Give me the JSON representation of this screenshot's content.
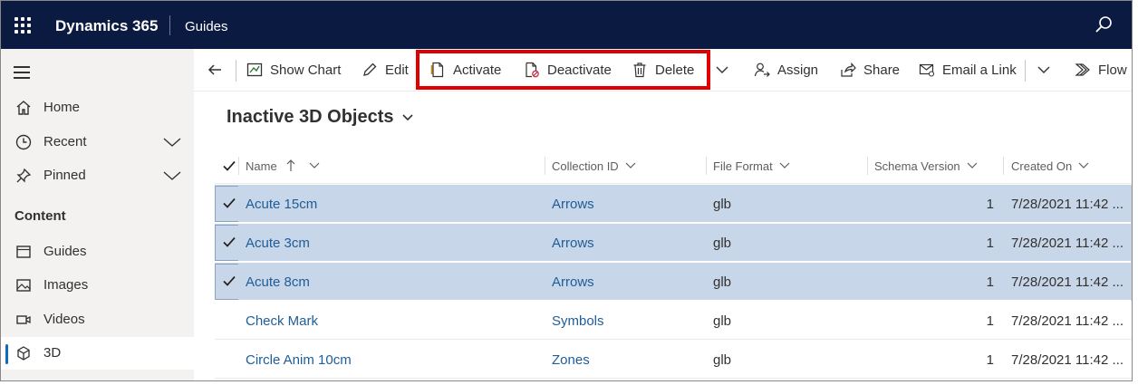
{
  "topbar": {
    "brand": "Dynamics 365",
    "app_name": "Guides"
  },
  "nav": {
    "items": [
      {
        "label": "Home",
        "icon": "home-icon"
      },
      {
        "label": "Recent",
        "icon": "clock-icon"
      },
      {
        "label": "Pinned",
        "icon": "pin-icon"
      }
    ],
    "group_title": "Content",
    "content_items": [
      {
        "label": "Guides",
        "icon": "window-icon"
      },
      {
        "label": "Images",
        "icon": "image-icon"
      },
      {
        "label": "Videos",
        "icon": "video-icon"
      },
      {
        "label": "3D",
        "icon": "cube-icon",
        "selected": true
      }
    ]
  },
  "commands": {
    "show_chart": "Show Chart",
    "edit": "Edit",
    "activate": "Activate",
    "deactivate": "Deactivate",
    "delete": "Delete",
    "assign": "Assign",
    "share": "Share",
    "email_link": "Email a Link",
    "flow": "Flow"
  },
  "view": {
    "title": "Inactive 3D Objects"
  },
  "grid": {
    "columns": [
      "Name",
      "Collection ID",
      "File Format",
      "Schema Version",
      "Created On"
    ],
    "rows": [
      {
        "name": "Acute 15cm",
        "collection": "Arrows",
        "format": "glb",
        "schema": "1",
        "created": "7/28/2021 11:42 ...",
        "selected": true
      },
      {
        "name": "Acute 3cm",
        "collection": "Arrows",
        "format": "glb",
        "schema": "1",
        "created": "7/28/2021 11:42 ...",
        "selected": true
      },
      {
        "name": "Acute 8cm",
        "collection": "Arrows",
        "format": "glb",
        "schema": "1",
        "created": "7/28/2021 11:42 ...",
        "selected": true
      },
      {
        "name": "Check Mark",
        "collection": "Symbols",
        "format": "glb",
        "schema": "1",
        "created": "7/28/2021 11:42 ...",
        "selected": false
      },
      {
        "name": "Circle Anim 10cm",
        "collection": "Zones",
        "format": "glb",
        "schema": "1",
        "created": "7/28/2021 11:42 ...",
        "selected": false
      }
    ]
  },
  "colors": {
    "topbar": "#0b1a40",
    "accent": "#0f6cbd",
    "selected_row": "#c7d6e8",
    "highlight_box": "#e00000",
    "link": "#1f5d99"
  }
}
